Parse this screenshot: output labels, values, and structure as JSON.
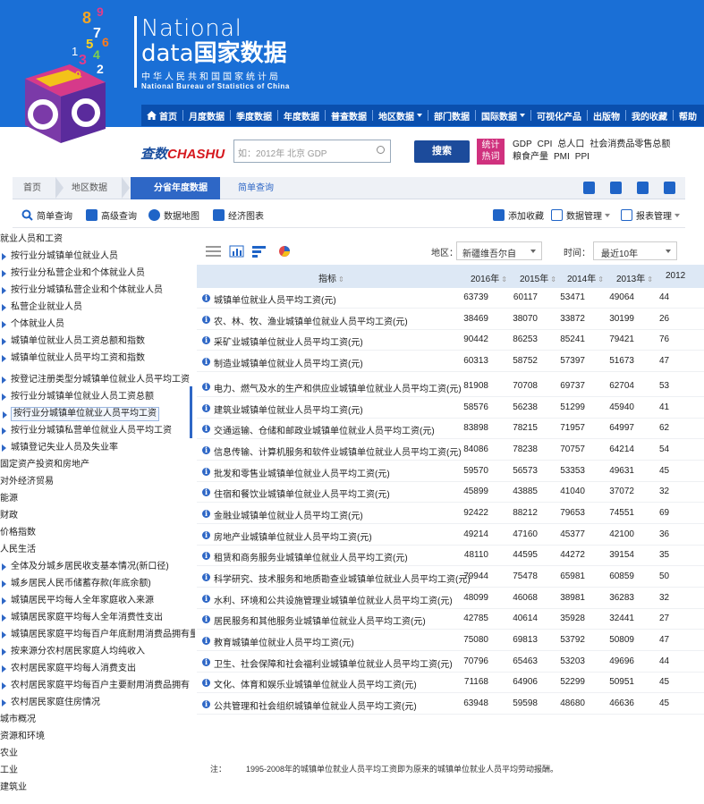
{
  "header": {
    "brand_en1": "National",
    "brand_en2": "data",
    "brand_cn": "国家数据",
    "subtitle_cn": "中华人民共和国国家统计局",
    "subtitle_en": "National Bureau of Statistics of China",
    "logo_digits": [
      "9",
      "8",
      "7",
      "5",
      "1",
      "3",
      "4",
      "6",
      "2",
      "0"
    ],
    "colors": {
      "header_bg": "#1a6fd6",
      "nav_bg": "#0a4fae",
      "accent": "#2e67c6"
    }
  },
  "nav": {
    "items": [
      {
        "label": "首页",
        "icon": "home-icon",
        "dropdown": false
      },
      {
        "label": "月度数据",
        "dropdown": false
      },
      {
        "label": "季度数据",
        "dropdown": false
      },
      {
        "label": "年度数据",
        "dropdown": false
      },
      {
        "label": "普查数据",
        "dropdown": false
      },
      {
        "label": "地区数据",
        "dropdown": true
      },
      {
        "label": "部门数据",
        "dropdown": false
      },
      {
        "label": "国际数据",
        "dropdown": true
      },
      {
        "label": "可视化产品",
        "dropdown": false
      },
      {
        "label": "出版物",
        "dropdown": false
      },
      {
        "label": "我的收藏",
        "dropdown": false
      },
      {
        "label": "帮助",
        "dropdown": false
      }
    ]
  },
  "search": {
    "logo_cn": "查数",
    "logo_en": "CHASHU",
    "placeholder": "如：2012年 北京 GDP",
    "button": "搜索",
    "hot_label_1": "统计",
    "hot_label_2": "热词",
    "hot_line1": [
      "GDP",
      "CPI",
      "总人口",
      "社会消费品零售总额"
    ],
    "hot_line2": [
      "粮食产量",
      "PMI",
      "PPI"
    ]
  },
  "breadcrumb": {
    "home": "首页",
    "region": "地区数据",
    "active": "分省年度数据",
    "query": "简单查询"
  },
  "toolbar": {
    "simple_query": "简单查询",
    "advanced_query": "高级查询",
    "data_map": "数据地图",
    "econ_chart": "经济图表",
    "add_fav": "添加收藏",
    "data_manage": "数据管理",
    "report_manage": "报表管理"
  },
  "sidebar": [
    {
      "label": "就业人员和工资",
      "level": 0
    },
    {
      "label": "按行业分城镇单位就业人员",
      "level": 1
    },
    {
      "label": "按行业分私营企业和个体就业人员",
      "level": 1
    },
    {
      "label": "按行业分城镇私营企业和个体就业人员",
      "level": 1
    },
    {
      "label": "私营企业就业人员",
      "level": 1
    },
    {
      "label": "个体就业人员",
      "level": 1
    },
    {
      "label": "城镇单位就业人员工资总额和指数",
      "level": 1
    },
    {
      "label": "城镇单位就业人员平均工资和指数",
      "level": 1
    },
    {
      "label": "按登记注册类型分城镇单位就业人员平均工资",
      "level": 1
    },
    {
      "label": "按行业分城镇单位就业人员工资总额",
      "level": 1
    },
    {
      "label": "按行业分城镇单位就业人员平均工资",
      "level": 1,
      "selected": true
    },
    {
      "label": "按行业分城镇私营单位就业人员平均工资",
      "level": 1
    },
    {
      "label": "城镇登记失业人员及失业率",
      "level": 1
    },
    {
      "label": "固定资产投资和房地产",
      "level": 0
    },
    {
      "label": "对外经济贸易",
      "level": 0
    },
    {
      "label": "能源",
      "level": 0
    },
    {
      "label": "财政",
      "level": 0
    },
    {
      "label": "价格指数",
      "level": 0
    },
    {
      "label": "人民生活",
      "level": 0
    },
    {
      "label": "全体及分城乡居民收支基本情况(新口径)",
      "level": 1
    },
    {
      "label": "城乡居民人民币储蓄存款(年底余额)",
      "level": 1
    },
    {
      "label": "城镇居民平均每人全年家庭收入来源",
      "level": 1
    },
    {
      "label": "城镇居民家庭平均每人全年消费性支出",
      "level": 1
    },
    {
      "label": "城镇居民家庭平均每百户年底耐用消费品拥有量",
      "level": 1
    },
    {
      "label": "按来源分农村居民家庭人均纯收入",
      "level": 1
    },
    {
      "label": "农村居民家庭平均每人消费支出",
      "level": 1
    },
    {
      "label": "农村居民家庭平均每百户主要耐用消费品拥有",
      "level": 1
    },
    {
      "label": "农村居民家庭住房情况",
      "level": 1
    },
    {
      "label": "城市概况",
      "level": 0
    },
    {
      "label": "资源和环境",
      "level": 0
    },
    {
      "label": "农业",
      "level": 0
    },
    {
      "label": "工业",
      "level": 0
    },
    {
      "label": "建筑业",
      "level": 0
    }
  ],
  "filters": {
    "region_label": "地区：",
    "region_value": "新疆维吾尔自",
    "time_label": "时间：",
    "time_value": "最近10年"
  },
  "table": {
    "indicator_header": "指标",
    "years": [
      "2016年",
      "2015年",
      "2014年",
      "2013年",
      "2012"
    ],
    "rows": [
      {
        "name": "城镇单位就业人员平均工资(元)",
        "values": [
          "63739",
          "60117",
          "53471",
          "49064",
          "44"
        ]
      },
      {
        "name": "农、林、牧、渔业城镇单位就业人员平均工资(元)",
        "values": [
          "38469",
          "38070",
          "33872",
          "30199",
          "26"
        ]
      },
      {
        "name": "采矿业城镇单位就业人员平均工资(元)",
        "values": [
          "90442",
          "86253",
          "85241",
          "79421",
          "76"
        ]
      },
      {
        "name": "制造业城镇单位就业人员平均工资(元)",
        "values": [
          "60313",
          "58752",
          "57397",
          "51673",
          "47"
        ]
      },
      {
        "name": "电力、燃气及水的生产和供应业城镇单位就业人员平均工资(元)",
        "values": [
          "81908",
          "70708",
          "69737",
          "62704",
          "53"
        ]
      },
      {
        "name": "建筑业城镇单位就业人员平均工资(元)",
        "values": [
          "58576",
          "56238",
          "51299",
          "45940",
          "41"
        ]
      },
      {
        "name": "交通运输、仓储和邮政业城镇单位就业人员平均工资(元)",
        "values": [
          "83898",
          "78215",
          "71957",
          "64997",
          "62"
        ]
      },
      {
        "name": "信息传输、计算机服务和软件业城镇单位就业人员平均工资(元)",
        "values": [
          "84086",
          "78238",
          "70757",
          "64214",
          "54"
        ]
      },
      {
        "name": "批发和零售业城镇单位就业人员平均工资(元)",
        "values": [
          "59570",
          "56573",
          "53353",
          "49631",
          "45"
        ]
      },
      {
        "name": "住宿和餐饮业城镇单位就业人员平均工资(元)",
        "values": [
          "45899",
          "43885",
          "41040",
          "37072",
          "32"
        ]
      },
      {
        "name": "金融业城镇单位就业人员平均工资(元)",
        "values": [
          "92422",
          "88212",
          "79653",
          "74551",
          "69"
        ]
      },
      {
        "name": "房地产业城镇单位就业人员平均工资(元)",
        "values": [
          "49214",
          "47160",
          "45377",
          "42100",
          "36"
        ]
      },
      {
        "name": "租赁和商务服务业城镇单位就业人员平均工资(元)",
        "values": [
          "48110",
          "44595",
          "44272",
          "39154",
          "35"
        ]
      },
      {
        "name": "科学研究、技术服务和地质勘查业城镇单位就业人员平均工资(元)",
        "values": [
          "79944",
          "75478",
          "65981",
          "60859",
          "50"
        ]
      },
      {
        "name": "水利、环境和公共设施管理业城镇单位就业人员平均工资(元)",
        "values": [
          "48099",
          "46068",
          "38981",
          "36283",
          "32"
        ]
      },
      {
        "name": "居民服务和其他服务业城镇单位就业人员平均工资(元)",
        "values": [
          "42785",
          "40614",
          "35928",
          "32441",
          "27"
        ]
      },
      {
        "name": "教育城镇单位就业人员平均工资(元)",
        "values": [
          "75080",
          "69813",
          "53792",
          "50809",
          "47"
        ]
      },
      {
        "name": "卫生、社会保障和社会福利业城镇单位就业人员平均工资(元)",
        "values": [
          "70796",
          "65463",
          "53203",
          "49696",
          "44"
        ]
      },
      {
        "name": "文化、体育和娱乐业城镇单位就业人员平均工资(元)",
        "values": [
          "71168",
          "64906",
          "52299",
          "50951",
          "45"
        ]
      },
      {
        "name": "公共管理和社会组织城镇单位就业人员平均工资(元)",
        "values": [
          "63948",
          "59598",
          "48680",
          "46636",
          "45"
        ]
      }
    ]
  },
  "note": {
    "label": "注：",
    "text": "1995-2008年的城镇单位就业人员平均工资即为原来的城镇单位就业人员平均劳动报酬。"
  }
}
